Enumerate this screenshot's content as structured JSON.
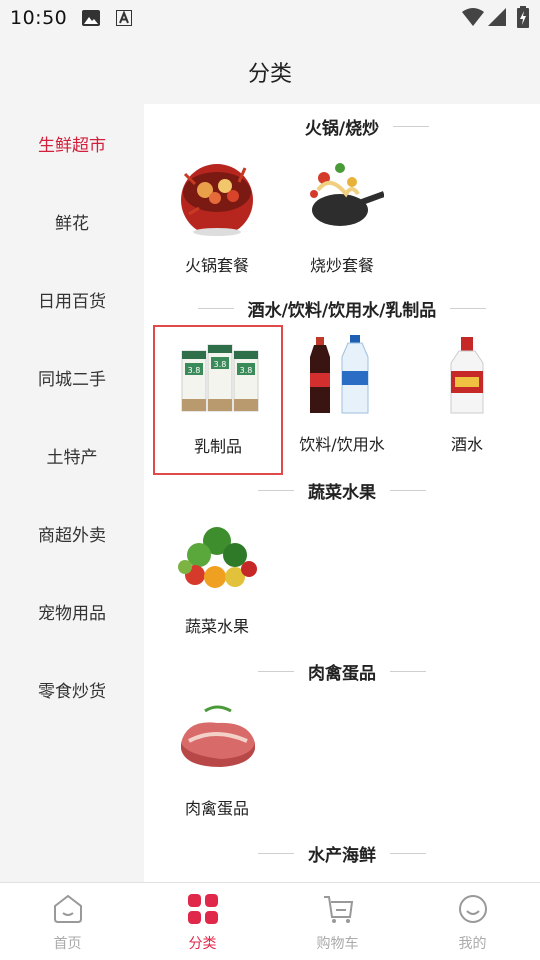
{
  "status_bar": {
    "time": "10:50"
  },
  "header": {
    "title": "分类"
  },
  "sidebar": {
    "items": [
      {
        "label": "生鲜超市",
        "active": true
      },
      {
        "label": "鲜花"
      },
      {
        "label": "日用百货"
      },
      {
        "label": "同城二手"
      },
      {
        "label": "土特产"
      },
      {
        "label": "商超外卖"
      },
      {
        "label": "宠物用品"
      },
      {
        "label": "零食炒货"
      }
    ]
  },
  "sections": [
    {
      "title": "火锅/烧炒",
      "items": [
        {
          "label": "火锅套餐",
          "icon": "hotpot-image"
        },
        {
          "label": "烧炒套餐",
          "icon": "wok-image"
        }
      ]
    },
    {
      "title": "酒水/饮料/饮用水/乳制品",
      "items": [
        {
          "label": "乳制品",
          "icon": "milk-boxes-image",
          "selected": true
        },
        {
          "label": "饮料/饮用水",
          "icon": "bottles-image"
        },
        {
          "label": "酒水",
          "icon": "baijiu-bottle-image"
        }
      ]
    },
    {
      "title": "蔬菜水果",
      "items": [
        {
          "label": "蔬菜水果",
          "icon": "vegetables-fruits-image"
        }
      ]
    },
    {
      "title": "肉禽蛋品",
      "items": [
        {
          "label": "肉禽蛋品",
          "icon": "raw-meat-image"
        }
      ]
    },
    {
      "title": "水产海鲜",
      "items": []
    }
  ],
  "milk_badge": "3.8",
  "tabbar": {
    "tabs": [
      {
        "label": "首页",
        "icon": "home-icon"
      },
      {
        "label": "分类",
        "icon": "category-icon",
        "active": true
      },
      {
        "label": "购物车",
        "icon": "cart-icon"
      },
      {
        "label": "我的",
        "icon": "profile-icon"
      }
    ]
  },
  "colors": {
    "accent": "#d21f3c",
    "selected_border": "#e04a4a",
    "sidebar_bg": "#f4f4f4"
  }
}
